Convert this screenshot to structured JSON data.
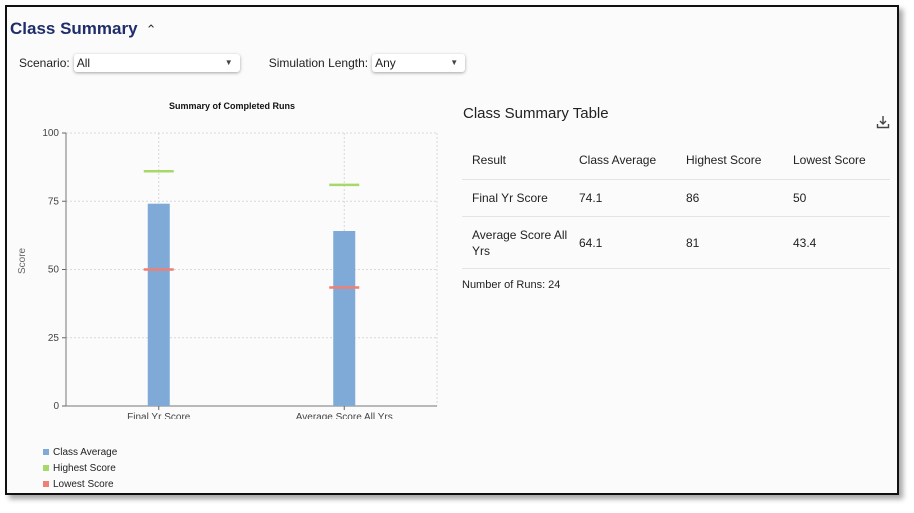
{
  "header": {
    "title": "Class Summary",
    "collapse_icon": "chevron-up-icon"
  },
  "filters": {
    "scenario": {
      "label": "Scenario:",
      "value": "All"
    },
    "simulation_length": {
      "label": "Simulation Length:",
      "value": "Any"
    }
  },
  "chart_data": {
    "type": "bar",
    "title": "Summary of Completed Runs",
    "xlabel": "",
    "ylabel": "Score",
    "ylim": [
      0,
      100
    ],
    "yticks": [
      0,
      25,
      50,
      75,
      100
    ],
    "categories": [
      "Final Yr Score",
      "Average Score All Yrs"
    ],
    "series": [
      {
        "name": "Class Average",
        "values": [
          74.1,
          64.1
        ],
        "color": "#7fa9d6",
        "mark": "bar"
      },
      {
        "name": "Highest Score",
        "values": [
          86,
          81
        ],
        "color": "#a6d96a",
        "mark": "tick"
      },
      {
        "name": "Lowest Score",
        "values": [
          50,
          43.4
        ],
        "color": "#f07f74",
        "mark": "tick"
      }
    ],
    "grid": true,
    "legend_position": "bottom-left"
  },
  "legend": [
    {
      "label": "Class Average",
      "color": "#7fa9d6"
    },
    {
      "label": "Highest Score",
      "color": "#a6d96a"
    },
    {
      "label": "Lowest Score",
      "color": "#f07f74"
    }
  ],
  "table": {
    "title": "Class Summary Table",
    "download_icon": "download-icon",
    "columns": [
      "Result",
      "Class Average",
      "Highest Score",
      "Lowest Score"
    ],
    "rows": [
      [
        "Final Yr Score",
        "74.1",
        "86",
        "50"
      ],
      [
        "Average Score All Yrs",
        "64.1",
        "81",
        "43.4"
      ]
    ]
  },
  "runs": {
    "label": "Number of Runs:",
    "value": "24"
  }
}
